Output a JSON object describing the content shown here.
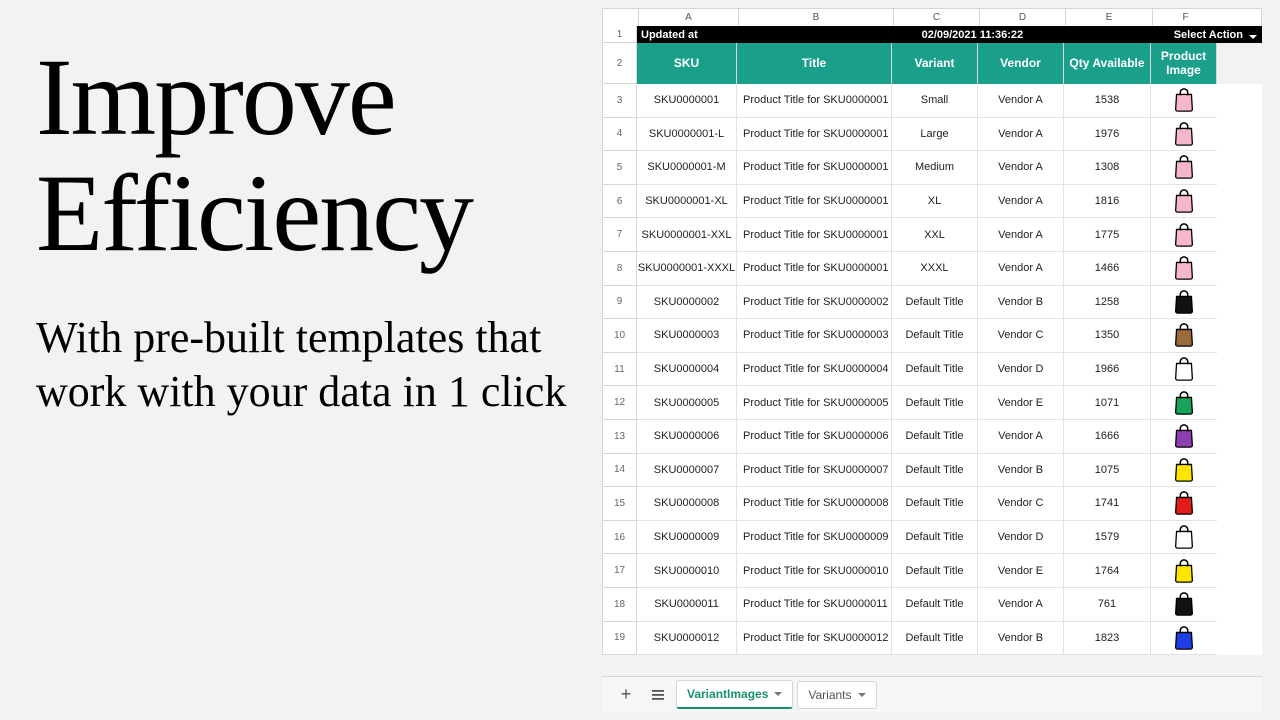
{
  "marketing": {
    "headline": "Improve Efficiency",
    "subhead": "With pre-built templates that work with your data in 1 click"
  },
  "sheet": {
    "column_letters": [
      "A",
      "B",
      "C",
      "D",
      "E",
      "F"
    ],
    "row1": {
      "label": "Updated at",
      "timestamp": "02/09/2021 11:36:22",
      "action": "Select Action"
    },
    "headers": [
      "SKU",
      "Title",
      "Variant",
      "Vendor",
      "Qty Available",
      "Product Image"
    ],
    "rows": [
      {
        "n": "3",
        "sku": "SKU0000001",
        "title": "Product Title for SKU0000001",
        "variant": "Small",
        "vendor": "Vendor A",
        "qty": "1538",
        "bag": "#f7b6cf"
      },
      {
        "n": "4",
        "sku": "SKU0000001-L",
        "title": "Product Title for SKU0000001",
        "variant": "Large",
        "vendor": "Vendor A",
        "qty": "1976",
        "bag": "#f7b6cf"
      },
      {
        "n": "5",
        "sku": "SKU0000001-M",
        "title": "Product Title for SKU0000001",
        "variant": "Medium",
        "vendor": "Vendor A",
        "qty": "1308",
        "bag": "#f7b6cf"
      },
      {
        "n": "6",
        "sku": "SKU0000001-XL",
        "title": "Product Title for SKU0000001",
        "variant": "XL",
        "vendor": "Vendor A",
        "qty": "1816",
        "bag": "#f7b6cf"
      },
      {
        "n": "7",
        "sku": "SKU0000001-XXL",
        "title": "Product Title for SKU0000001",
        "variant": "XXL",
        "vendor": "Vendor A",
        "qty": "1775",
        "bag": "#f7b6cf"
      },
      {
        "n": "8",
        "sku": "SKU0000001-XXXL",
        "title": "Product Title for SKU0000001",
        "variant": "XXXL",
        "vendor": "Vendor A",
        "qty": "1466",
        "bag": "#f7b6cf"
      },
      {
        "n": "9",
        "sku": "SKU0000002",
        "title": "Product Title for SKU0000002",
        "variant": "Default Title",
        "vendor": "Vendor B",
        "qty": "1258",
        "bag": "#111111"
      },
      {
        "n": "10",
        "sku": "SKU0000003",
        "title": "Product Title for SKU0000003",
        "variant": "Default Title",
        "vendor": "Vendor C",
        "qty": "1350",
        "bag": "#9a6a3a"
      },
      {
        "n": "11",
        "sku": "SKU0000004",
        "title": "Product Title for SKU0000004",
        "variant": "Default Title",
        "vendor": "Vendor D",
        "qty": "1966",
        "bag": "#ffffff"
      },
      {
        "n": "12",
        "sku": "SKU0000005",
        "title": "Product Title for SKU0000005",
        "variant": "Default Title",
        "vendor": "Vendor E",
        "qty": "1071",
        "bag": "#18a158"
      },
      {
        "n": "13",
        "sku": "SKU0000006",
        "title": "Product Title for SKU0000006",
        "variant": "Default Title",
        "vendor": "Vendor A",
        "qty": "1666",
        "bag": "#8d3fb0"
      },
      {
        "n": "14",
        "sku": "SKU0000007",
        "title": "Product Title for SKU0000007",
        "variant": "Default Title",
        "vendor": "Vendor B",
        "qty": "1075",
        "bag": "#ffe600"
      },
      {
        "n": "15",
        "sku": "SKU0000008",
        "title": "Product Title for SKU0000008",
        "variant": "Default Title",
        "vendor": "Vendor C",
        "qty": "1741",
        "bag": "#e21b1b"
      },
      {
        "n": "16",
        "sku": "SKU0000009",
        "title": "Product Title for SKU0000009",
        "variant": "Default Title",
        "vendor": "Vendor D",
        "qty": "1579",
        "bag": "#ffffff"
      },
      {
        "n": "17",
        "sku": "SKU0000010",
        "title": "Product Title for SKU0000010",
        "variant": "Default Title",
        "vendor": "Vendor E",
        "qty": "1764",
        "bag": "#ffe600"
      },
      {
        "n": "18",
        "sku": "SKU0000011",
        "title": "Product Title for SKU0000011",
        "variant": "Default Title",
        "vendor": "Vendor A",
        "qty": "761",
        "bag": "#111111"
      },
      {
        "n": "19",
        "sku": "SKU0000012",
        "title": "Product Title for SKU0000012",
        "variant": "Default Title",
        "vendor": "Vendor B",
        "qty": "1823",
        "bag": "#1f3fe6"
      }
    ]
  },
  "tabs": {
    "active": "VariantImages",
    "other": "Variants"
  }
}
